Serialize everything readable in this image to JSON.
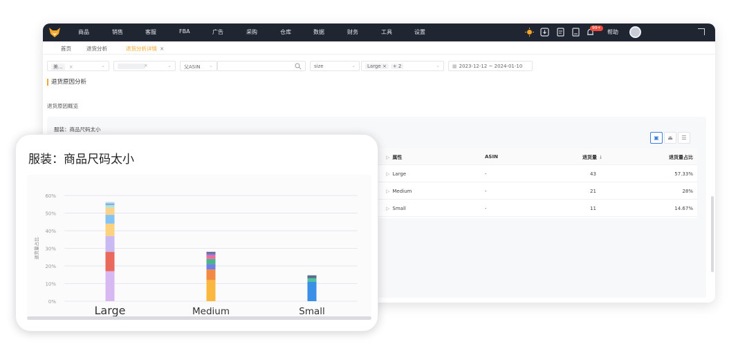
{
  "nav": {
    "items": [
      "商品",
      "销售",
      "客服",
      "FBA",
      "广告",
      "采购",
      "仓库",
      "数据",
      "财务",
      "工具",
      "设置"
    ],
    "badge": "99+",
    "help": "帮助"
  },
  "tabs": [
    {
      "label": "首页",
      "active": false
    },
    {
      "label": "退货分析",
      "active": false
    },
    {
      "label": "退货分析详情",
      "active": true,
      "close": "×"
    }
  ],
  "filters": {
    "store": {
      "value": "美...",
      "clear": "×"
    },
    "shop": {
      "clear": "×"
    },
    "asin_type": "父ASIN",
    "attribute": "size",
    "size_values": {
      "chip": "Large",
      "clear": "×",
      "more": "+ 2"
    },
    "date_range": "2023-12-12 ~ 2024-01-10"
  },
  "section": {
    "title": "退货原因分析",
    "subtitle": "退货原因概览",
    "panel_label": "服装：商品尺码太小"
  },
  "view_buttons": [
    "table-icon",
    "chart-icon",
    "list-icon"
  ],
  "table": {
    "headers": {
      "attr": "属性",
      "asin": "ASIN",
      "qty": "退货量",
      "qty_sort": "↓",
      "ratio": "退货量占比"
    },
    "rows": [
      {
        "attr": "Large",
        "asin": "-",
        "qty": "43",
        "ratio": "57.33%"
      },
      {
        "attr": "Medium",
        "asin": "-",
        "qty": "21",
        "ratio": "28%"
      },
      {
        "attr": "Small",
        "asin": "-",
        "qty": "11",
        "ratio": "14.67%"
      }
    ]
  },
  "card": {
    "title": "服装：商品尺码太小"
  },
  "colors": {
    "accent": "#f4a62a",
    "nav_bg": "#1f2531",
    "active_view": "#3b7ddd"
  },
  "chart_data": {
    "type": "bar",
    "stacked": true,
    "title": "",
    "xlabel": "",
    "ylabel": "退货量占比",
    "ylim": [
      0,
      60
    ],
    "yticks": [
      "0%",
      "10%",
      "20%",
      "30%",
      "40%",
      "50%",
      "60%"
    ],
    "grid": true,
    "categories": [
      "Large",
      "Medium",
      "Small"
    ],
    "stacks": [
      [
        {
          "value": 17,
          "color": "#d8b8f2"
        },
        {
          "value": 11,
          "color": "#e96a5c"
        },
        {
          "value": 9,
          "color": "#c9b8f2"
        },
        {
          "value": 7,
          "color": "#fcd27f"
        },
        {
          "value": 5,
          "color": "#84c3f2"
        },
        {
          "value": 4,
          "color": "#f9d28d"
        },
        {
          "value": 1.5,
          "color": "#b7e3d3"
        },
        {
          "value": 1,
          "color": "#7fb1e6"
        },
        {
          "value": 0.83,
          "color": "#c6d9ee"
        }
      ],
      [
        {
          "value": 12,
          "color": "#fbb840"
        },
        {
          "value": 6,
          "color": "#f28a42"
        },
        {
          "value": 3,
          "color": "#6f7fe6"
        },
        {
          "value": 3,
          "color": "#4ab48f"
        },
        {
          "value": 2,
          "color": "#f06c9b"
        },
        {
          "value": 1,
          "color": "#8b6fd6"
        },
        {
          "value": 1,
          "color": "#5a6b8c"
        }
      ],
      [
        {
          "value": 11,
          "color": "#3a8fe6"
        },
        {
          "value": 2,
          "color": "#4fc2a0"
        },
        {
          "value": 1.67,
          "color": "#5a6b8c"
        }
      ]
    ]
  }
}
